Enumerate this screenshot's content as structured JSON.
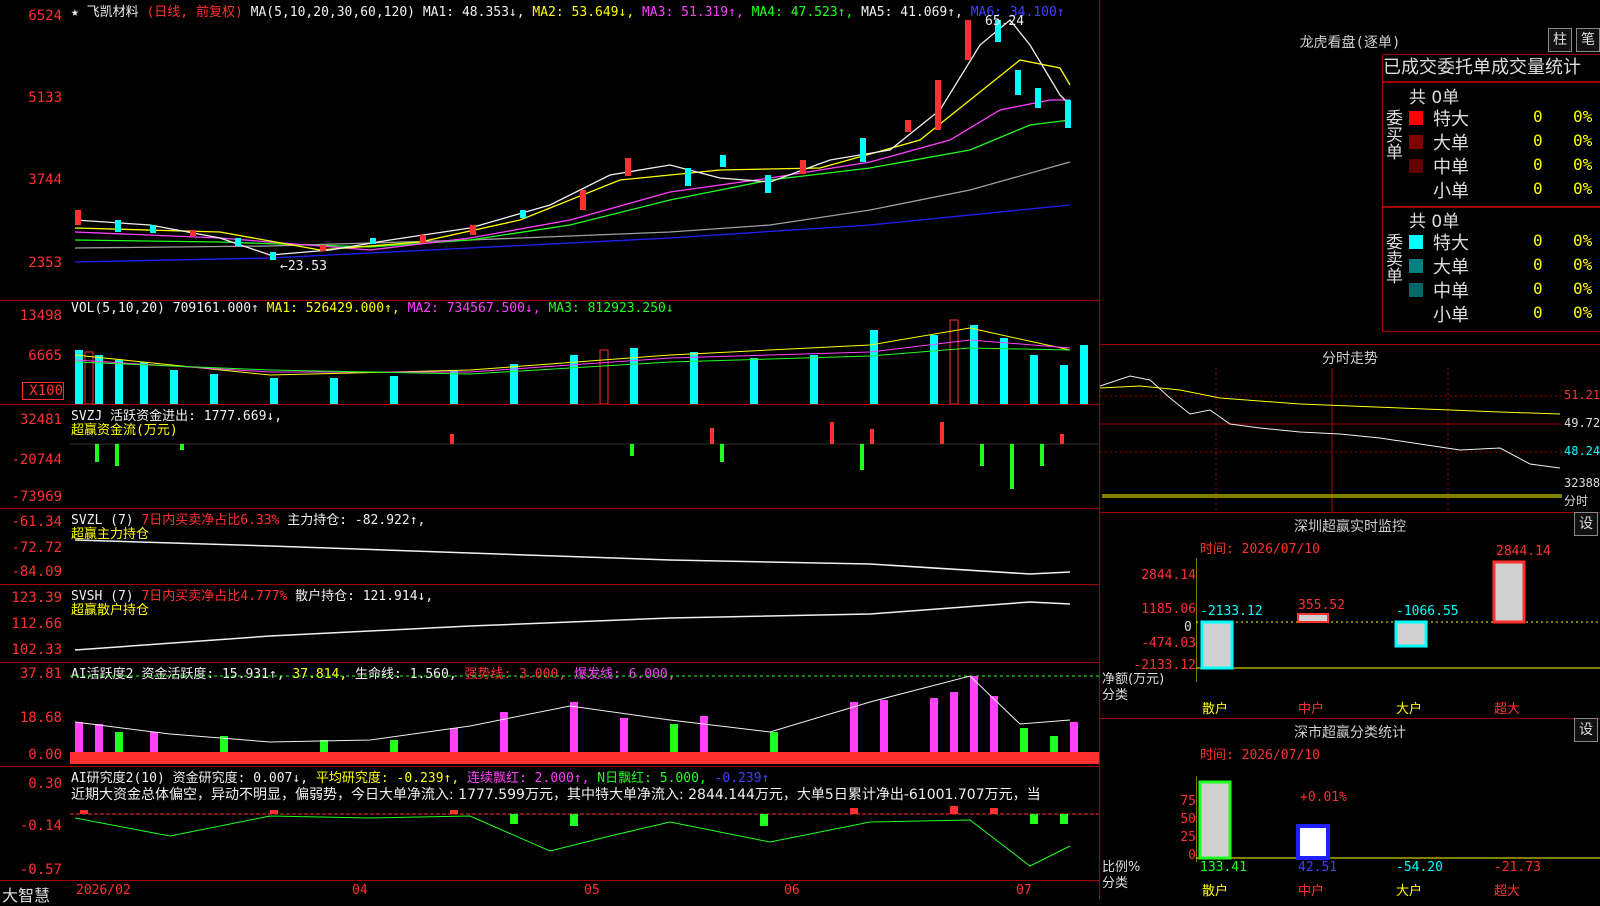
{
  "main": {
    "stock_name": "★ 飞凯材料",
    "period_note": "(日线, 前复权)",
    "ma_label": "MA(5,10,20,30,60,120)",
    "ma1": "MA1: 48.353↓,",
    "ma2": "MA2: 53.649↓,",
    "ma3": "MA3: 51.319↑,",
    "ma4": "MA4: 47.523↑,",
    "ma5": "MA5: 41.069↑,",
    "ma6": "MA6: 34.100↑",
    "y_ticks": [
      "6524",
      "5133",
      "3744",
      "2353"
    ],
    "high_marker": "65.24",
    "low_marker": "←23.53",
    "up_arrow": "▼"
  },
  "volume": {
    "label": "VOL(5,10,20)",
    "value": "709161.000↑",
    "ma1": "MA1: 526429.000↑,",
    "ma2": "MA2: 734567.500↓,",
    "ma3": "MA3: 812923.250↓",
    "y_ticks": [
      "13498",
      "6665",
      "X100"
    ]
  },
  "svzj": {
    "label": "SVZJ",
    "value": "活跃资金进出: 1777.669↓,",
    "sub": "超赢资金流(万元)",
    "y_ticks": [
      "32481",
      "-20744",
      "-73969"
    ]
  },
  "svzl": {
    "label": "SVZL (7)",
    "ratio": "7日内买卖净占比6.33%",
    "value": "主力持仓: -82.922↑,",
    "sub": "超赢主力持仓",
    "y_ticks": [
      "-61.34",
      "-72.72",
      "-84.09"
    ]
  },
  "svsh": {
    "label": "SVSH (7)",
    "ratio": "7日内买卖净占比4.777%",
    "value": "散户持仓: 121.914↓,",
    "sub": "超赢散户持仓",
    "y_ticks": [
      "123.39",
      "112.66",
      "102.33"
    ]
  },
  "ai1": {
    "label": "AI活跃度2",
    "v1": "资金活跃度: 15.931↑,",
    "v2": "37.814,",
    "v3": "生命线: 1.560,",
    "v4": "强势线: 3.000,",
    "v5": "爆发线: 6.000,",
    "y_ticks": [
      "37.81",
      "18.68",
      "0.00"
    ]
  },
  "ai2": {
    "label": "AI研究度2(10)",
    "v1": "资金研究度: 0.007↓,",
    "v2": "平均研究度: -0.239↑,",
    "v3": "连续飘红: 2.000↑,",
    "v4": "N日飘红: 5.000,",
    "v5": "-0.239↑",
    "summary": "近期大资金总体偏空，异动不明显，偏弱势，今日大单净流入: 1777.599万元，其中特大单净流入: 2844.144万元，大单5日累计净出-61001.707万元，当",
    "y_ticks": [
      "0.30",
      "-0.14",
      "-0.57"
    ]
  },
  "xaxis": {
    "brand": "大智慧",
    "labels": [
      "2026/02",
      "04",
      "05",
      "06",
      "07"
    ]
  },
  "dragon": {
    "title": "龙虎看盘(逐单)",
    "btn_col": "柱",
    "btn_pen": "笔",
    "header": "已成交委托单成交量统计",
    "buy_side": "委买单",
    "sell_side": "委卖单",
    "buy_total": "共 0单",
    "sell_total": "共 0单",
    "rows": [
      "特大",
      "大单",
      "中单",
      "小单"
    ],
    "zero": "0",
    "pct": "0%"
  },
  "intraday": {
    "title": "分时走势",
    "y_ticks": [
      "51.21",
      "49.72",
      "48.24",
      "32388",
      "分时"
    ]
  },
  "sz_monitor": {
    "title": "深圳超赢实时监控",
    "settings": "设",
    "time": "时间: 2026/07/10",
    "y_ticks": [
      "2844.14",
      "1185.06",
      "-474.03",
      "-2133.12"
    ],
    "values": [
      "-2133.12",
      "355.52",
      "-1066.55",
      "2844.14"
    ],
    "y_title_1": "净额(万元)",
    "y_title_2": "分类",
    "cats": [
      "散户",
      "中户",
      "大户",
      "超大"
    ],
    "zero": "0"
  },
  "sz_class": {
    "title": "深市超赢分类统计",
    "settings": "设",
    "time": "时间: 2026/07/10",
    "y_ticks": [
      "75",
      "50",
      "25",
      "0"
    ],
    "bar_label": "+0.01%",
    "values": [
      "133.41",
      "42.51",
      "-54.20",
      "-21.73"
    ],
    "y_title_1": "比例%",
    "y_title_2": "分类",
    "cats": [
      "散户",
      "中户",
      "大户",
      "超大"
    ]
  },
  "colors": {
    "up": "#ff3030",
    "down": "#00ffff",
    "ma1": "#f0f0f0",
    "ma2": "#ffff00",
    "ma3": "#ff40ff",
    "ma4": "#20ff20",
    "ma5": "#a0a0a0",
    "ma6": "#2020ff"
  }
}
